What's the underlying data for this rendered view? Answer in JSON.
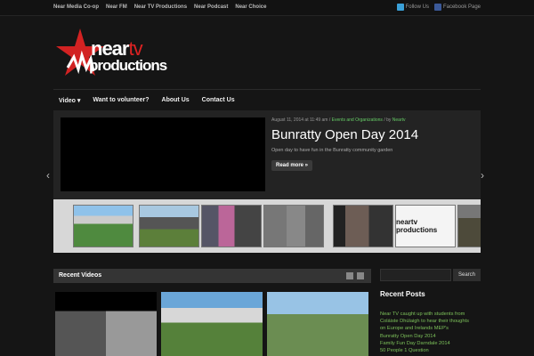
{
  "topnav": [
    "Near Media Co-op",
    "Near FM",
    "Near TV Productions",
    "Near Podcast",
    "Near Choice"
  ],
  "social": {
    "follow": "Follow Us",
    "facebook": "Facebook Page"
  },
  "logo": {
    "line1": "near",
    "line2": "tv",
    "line3": "productions"
  },
  "mainnav": [
    "Video ▾",
    "Want to volunteer?",
    "About Us",
    "Contact Us"
  ],
  "slider": {
    "meta_date": "August 11, 2014 at 11:49 am",
    "meta_category": "Events and Organizations",
    "meta_by": "by",
    "meta_author": "Neartv",
    "title": "Bunratty Open Day 2014",
    "description": "Open day to have fun in the Bunratty community garden",
    "readmore": "Read more »",
    "prev_arrow": "‹",
    "next_arrow": "›"
  },
  "thumb_logo": "neartv productions",
  "recent_videos": {
    "title": "Recent Videos"
  },
  "search": {
    "button": "Search"
  },
  "recent_posts": {
    "title": "Recent Posts",
    "items": [
      "Near TV caught up with students from",
      "Coláiste Dhúlaigh to hear their thoughts",
      "on Europe and Irelands MEP's",
      "Bunratty Open Day 2014",
      "Family Fun Day Darndale 2014",
      "50 People 1 Question"
    ]
  },
  "colors": {
    "accent": "#7cc05a",
    "brand_red": "#d22222"
  }
}
